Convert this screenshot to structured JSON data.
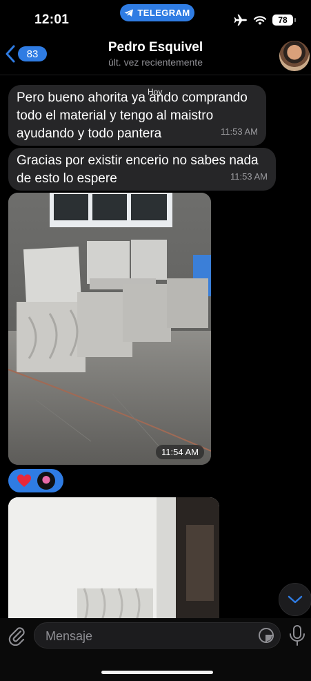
{
  "status_bar": {
    "time": "12:01",
    "app_pill": "TELEGRAM",
    "battery": "78"
  },
  "header": {
    "back_count": "83",
    "contact_name": "Pedro Esquivel",
    "contact_status": "últ. vez recientemente"
  },
  "chat": {
    "date_label": "Hoy",
    "messages": [
      {
        "text": "Pero bueno ahorita ya ando comprando todo el material y tengo al maistro ayudando y todo pantera",
        "time": "11:53 AM"
      },
      {
        "text": "Gracias por existir encerio no sabes nada de esto lo espere",
        "time": "11:53 AM"
      },
      {
        "type": "photo",
        "time": "11:54 AM"
      }
    ],
    "reactions": [
      "heart",
      "avatar"
    ]
  },
  "composer": {
    "placeholder": "Mensaje"
  },
  "colors": {
    "accent": "#2f7ce3",
    "bubble": "#262628",
    "background": "#000000"
  }
}
